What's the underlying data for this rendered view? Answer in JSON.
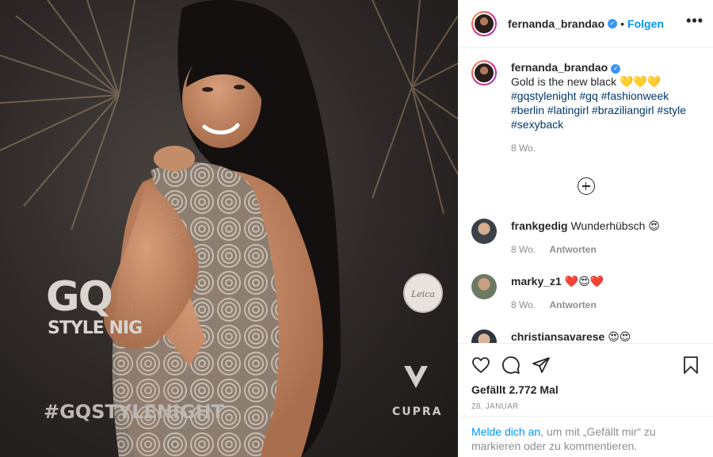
{
  "header": {
    "username": "fernanda_brandao",
    "separator": "•",
    "follow_label": "Folgen",
    "more_label": "•••"
  },
  "caption": {
    "username": "fernanda_brandao",
    "text": "Gold is the new black 💛💛💛",
    "hashtags": "#gqstylenight #gq #fashionweek #berlin #latingirl #braziliangirl #style #sexyback",
    "time": "8 Wo."
  },
  "comments": [
    {
      "username": "frankgedig",
      "text": "Wunderhübsch 😍",
      "time": "8 Wo.",
      "reply": "Antworten"
    },
    {
      "username": "marky_z1",
      "text": "❤️😍❤️",
      "time": "8 Wo.",
      "reply": "Antworten"
    },
    {
      "username": "christiansavarese",
      "text": "😍😍"
    }
  ],
  "actions": {
    "likes": "Gefällt 2.772 Mal",
    "date": "28. JANUAR"
  },
  "login": {
    "link": "Melde dich an",
    "rest": ", um mit „Gefällt mir“ zu markieren oder zu kommentieren."
  },
  "photo": {
    "watermark_gq": "GQ",
    "watermark_style": "STYLE NIG",
    "watermark_tag": "#GQSTYLENIGHT",
    "watermark_cupra": "CUPRA",
    "watermark_leica": "Leica"
  },
  "icons": {
    "verified": "verified-badge-icon",
    "like": "heart-icon",
    "comment": "comment-bubble-icon",
    "share": "paper-plane-icon",
    "save": "bookmark-icon",
    "load_more": "plus-circle-icon"
  },
  "colors": {
    "link_blue": "#0095f6",
    "hashtag": "#00376b",
    "muted": "#8e8e8e",
    "verified": "#3897f0"
  }
}
